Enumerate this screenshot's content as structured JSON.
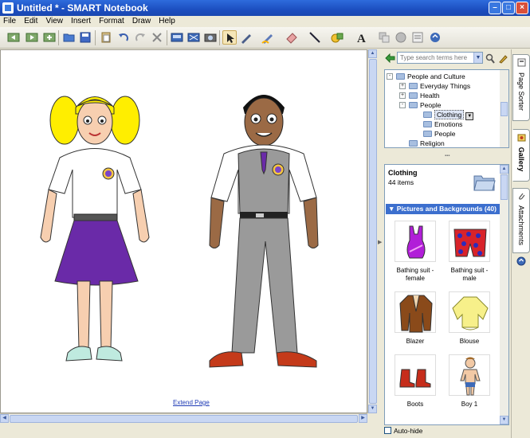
{
  "window": {
    "title": "Untitled * - SMART Notebook"
  },
  "menu": [
    "File",
    "Edit",
    "View",
    "Insert",
    "Format",
    "Draw",
    "Help"
  ],
  "canvas": {
    "extend_link": "Extend Page"
  },
  "search": {
    "placeholder": "Type search terms here"
  },
  "tree": [
    {
      "label": "People and Culture",
      "level": 0,
      "expand": "-"
    },
    {
      "label": "Everyday Things",
      "level": 1,
      "expand": "+"
    },
    {
      "label": "Health",
      "level": 1,
      "expand": "+"
    },
    {
      "label": "People",
      "level": 1,
      "expand": "-"
    },
    {
      "label": "Clothing",
      "level": 2,
      "expand": "",
      "selected": true
    },
    {
      "label": "Emotions",
      "level": 2,
      "expand": ""
    },
    {
      "label": "People",
      "level": 2,
      "expand": ""
    },
    {
      "label": "Religion",
      "level": 1,
      "expand": ""
    }
  ],
  "gallery": {
    "collection_name": "Clothing",
    "item_count": "44 items",
    "section_label": "▼ Pictures and Backgrounds (40)",
    "items": [
      {
        "label": "Bathing suit - female",
        "icon": "bathing-suit-female-icon"
      },
      {
        "label": "Bathing suit - male",
        "icon": "bathing-suit-male-icon"
      },
      {
        "label": "Blazer",
        "icon": "blazer-icon"
      },
      {
        "label": "Blouse",
        "icon": "blouse-icon"
      },
      {
        "label": "Boots",
        "icon": "boots-icon"
      },
      {
        "label": "Boy 1",
        "icon": "boy-icon"
      }
    ]
  },
  "autohide": {
    "label": "Auto-hide"
  },
  "tabs": {
    "page_sorter": "Page Sorter",
    "gallery": "Gallery",
    "attachments": "Attachments"
  },
  "colors": {
    "title_blue": "#1c4fc0",
    "section_blue": "#3c6fce",
    "skirt_purple": "#6a2aa8"
  }
}
